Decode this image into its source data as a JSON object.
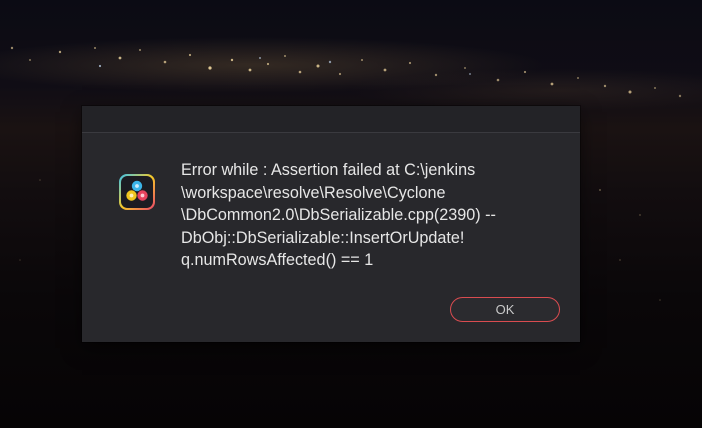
{
  "dialog": {
    "title": "",
    "icon": "davinci-resolve-app-icon",
    "message": "Error while : Assertion failed at C:\\jenkins\n\\workspace\\resolve\\Resolve\\Cyclone\n\\DbCommon2.0\\DbSerializable.cpp(2390) --\nDbObj::DbSerializable::InsertOrUpdate!\nq.numRowsAffected() == 1",
    "ok_label": "OK"
  },
  "colors": {
    "dialog_bg": "#28282c",
    "titlebar_bg": "#232327",
    "text": "#e6e6e6",
    "button_border": "#d94c50",
    "button_text": "#c9c9c9"
  }
}
